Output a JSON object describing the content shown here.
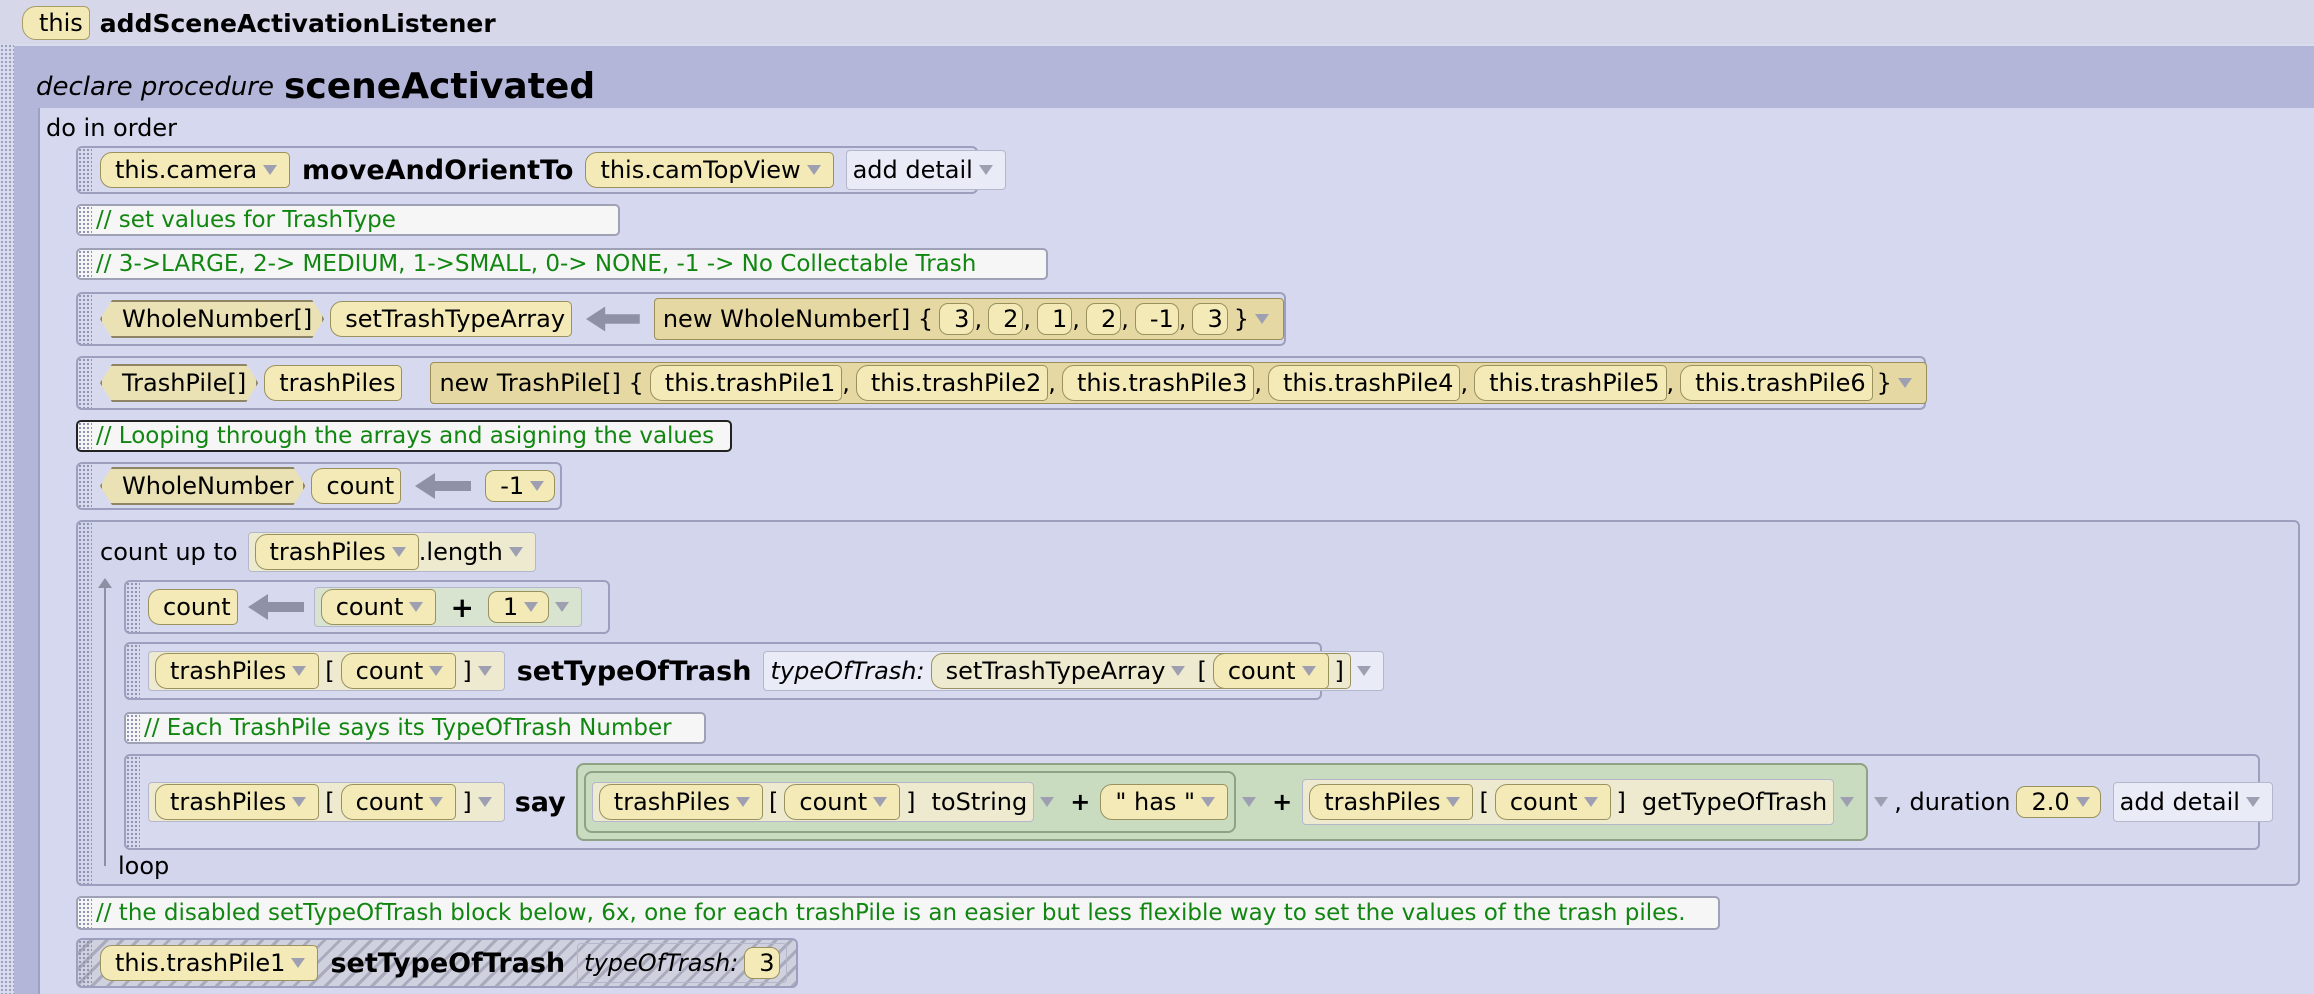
{
  "header": {
    "this_label": "this",
    "method": "addSceneActivationListener"
  },
  "procedure": {
    "declare_label": "declare procedure",
    "name": "sceneActivated",
    "do_in_order": "do in order"
  },
  "statements": {
    "move": {
      "target": "this.camera",
      "method": "moveAndOrientTo",
      "arg": "this.camTopView",
      "detail": "add detail"
    },
    "comment1": "// set values for TrashType",
    "comment2": "// 3->LARGE, 2-> MEDIUM, 1->SMALL, 0-> NONE, -1 -> No Collectable Trash",
    "assign1": {
      "type": "WholeNumber[]",
      "var": "setTrashTypeArray",
      "new": "new WholeNumber[] {",
      "values": [
        "3",
        "2",
        "1",
        "2",
        "-1",
        "3"
      ],
      "close": "}"
    },
    "assign2": {
      "type": "TrashPile[]",
      "var": "trashPiles",
      "new": "new TrashPile[] {",
      "values": [
        "this.trashPile1",
        "this.trashPile2",
        "this.trashPile3",
        "this.trashPile4",
        "this.trashPile5",
        "this.trashPile6"
      ],
      "close": "}"
    },
    "comment3": "// Looping through the arrays and asigning the values",
    "assign3": {
      "type": "WholeNumber",
      "var": "count",
      "value": "-1"
    },
    "loop": {
      "label": "count up to",
      "array": "trashPiles",
      "length": ".length",
      "end": "loop",
      "inc": {
        "var": "count",
        "lhs": "count",
        "plus": "+",
        "rhs": "1"
      },
      "set": {
        "array": "trashPiles",
        "open": "[",
        "index": "count",
        "close": "]",
        "method": "setTypeOfTrash",
        "param": "typeOfTrash:",
        "src": "setTrashTypeArray",
        "srcindex": "count"
      },
      "comment": "// Each TrashPile says its TypeOfTrash Number",
      "say": {
        "array": "trashPiles",
        "index": "count",
        "method": "say",
        "tostring": "toString",
        "plus": "+",
        "has": "\" has \"",
        "get": "getTypeOfTrash",
        "duration": ", duration",
        "durval": "2.0",
        "detail": "add detail"
      }
    },
    "comment4": "// the disabled setTypeOfTrash block below, 6x, one for each trashPile is an easier but less flexible way to set the values of the trash piles.",
    "disabled": {
      "target": "this.trashPile1",
      "method": "setTypeOfTrash",
      "param": "typeOfTrash:",
      "value": "3"
    }
  }
}
